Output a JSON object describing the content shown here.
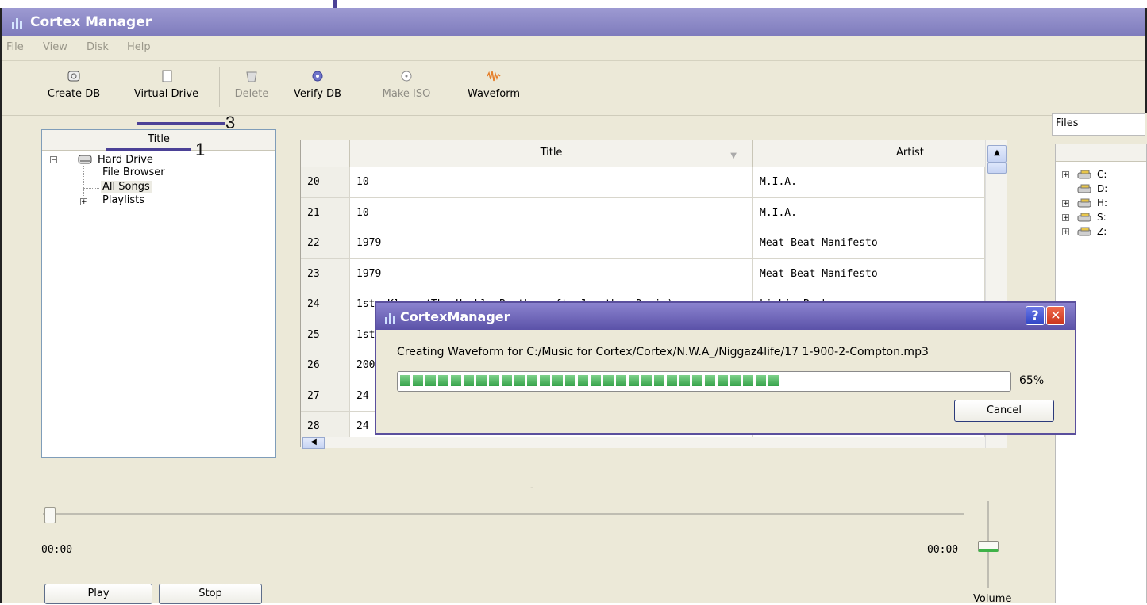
{
  "window": {
    "title": "Cortex Manager",
    "menu": [
      "File",
      "View",
      "Disk",
      "Help"
    ]
  },
  "toolbar": {
    "buttons": [
      {
        "label": "Create DB",
        "icon": "database-icon",
        "enabled": true
      },
      {
        "label": "Virtual Drive",
        "icon": "drive-icon",
        "enabled": true
      },
      {
        "label": "Delete",
        "icon": "trash-icon",
        "enabled": false
      },
      {
        "label": "Verify DB",
        "icon": "verify-icon",
        "enabled": true
      },
      {
        "label": "Make ISO",
        "icon": "disc-icon",
        "enabled": false
      },
      {
        "label": "Waveform",
        "icon": "waveform-icon",
        "enabled": true
      }
    ]
  },
  "tree": {
    "header": "Title",
    "root": "Hard Drive",
    "items": [
      "File Browser",
      "All Songs",
      "Playlists"
    ]
  },
  "table": {
    "columns": [
      "Title",
      "Artist"
    ],
    "rows": [
      {
        "num": "20",
        "title": "10",
        "artist": "M.I.A."
      },
      {
        "num": "21",
        "title": "10",
        "artist": "M.I.A."
      },
      {
        "num": "22",
        "title": "1979",
        "artist": "Meat Beat Manifesto"
      },
      {
        "num": "23",
        "title": "1979",
        "artist": "Meat Beat Manifesto"
      },
      {
        "num": "24",
        "title": "1stp Klosr (The Humble Brothers ft. Jonathan Davis)",
        "artist": "Linkin Park"
      },
      {
        "num": "25",
        "title": "1st",
        "artist": ""
      },
      {
        "num": "26",
        "title": "200",
        "artist": ""
      },
      {
        "num": "27",
        "title": "24",
        "artist": ""
      },
      {
        "num": "28",
        "title": "24",
        "artist": ""
      }
    ]
  },
  "files": {
    "header": "Files",
    "drives": [
      "C:",
      "D:",
      "H:",
      "S:",
      "Z:"
    ]
  },
  "player": {
    "track_label": "-",
    "elapsed": "00:00",
    "remaining": "00:00",
    "play_label": "Play",
    "stop_label": "Stop",
    "volume_label": "Volume"
  },
  "dialog": {
    "title": "CortexManager",
    "message": "Creating Waveform for C:/Music for Cortex/Cortex/N.W.A_/Niggaz4life/17 1-900-2-Compton.mp3",
    "progress": 0.65,
    "progress_text": "65%",
    "cancel_label": "Cancel",
    "help_label": "?"
  },
  "annotations": [
    "1",
    "3"
  ]
}
